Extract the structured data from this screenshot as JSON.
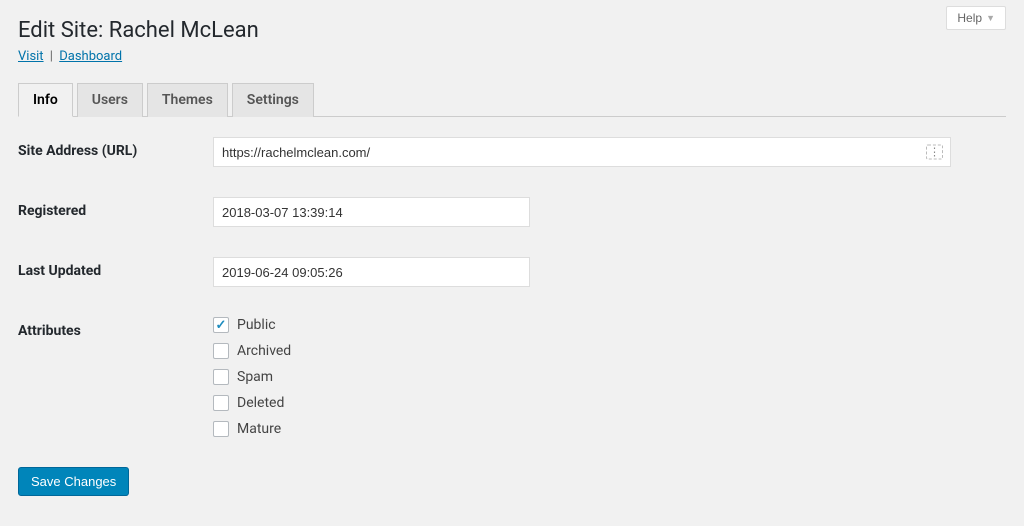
{
  "help": {
    "label": "Help"
  },
  "header": {
    "title": "Edit Site: Rachel McLean",
    "links": {
      "visit": "Visit",
      "dashboard": "Dashboard"
    }
  },
  "tabs": [
    {
      "label": "Info",
      "active": true
    },
    {
      "label": "Users",
      "active": false
    },
    {
      "label": "Themes",
      "active": false
    },
    {
      "label": "Settings",
      "active": false
    }
  ],
  "form": {
    "site_address": {
      "label": "Site Address (URL)",
      "value": "https://rachelmclean.com/"
    },
    "registered": {
      "label": "Registered",
      "value": "2018-03-07 13:39:14"
    },
    "last_updated": {
      "label": "Last Updated",
      "value": "2019-06-24 09:05:26"
    },
    "attributes": {
      "label": "Attributes",
      "items": [
        {
          "label": "Public",
          "checked": true
        },
        {
          "label": "Archived",
          "checked": false
        },
        {
          "label": "Spam",
          "checked": false
        },
        {
          "label": "Deleted",
          "checked": false
        },
        {
          "label": "Mature",
          "checked": false
        }
      ]
    },
    "submit_label": "Save Changes"
  }
}
